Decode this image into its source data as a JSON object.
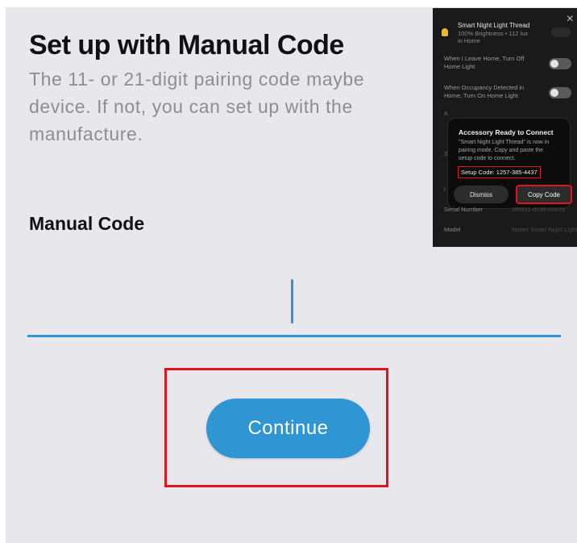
{
  "page": {
    "title": "Set up with Manual Code",
    "description_lines": [
      "The 11- or 21-digit pairing code maybe",
      "device. If not, you can set up with the",
      "manufacture."
    ],
    "field_label": "Manual Code",
    "manual_code_value": "",
    "continue_label": "Continue"
  },
  "inset": {
    "close_glyph": "×",
    "device_name": "Smart Night Light Thread",
    "device_status_line1": "100% Brightness • 112 lux",
    "device_status_line2": "in Home",
    "rows": [
      {
        "line1": "When I Leave Home, Turn Off",
        "line2": "Home Light"
      },
      {
        "line1": "When Occupancy Detected in",
        "line2": "Home, Turn On Home Light"
      }
    ],
    "dialog": {
      "title": "Accessory Ready to Connect",
      "body_lines": [
        "\"Smart Night Light Thread\" is now in",
        "pairing mode. Copy and paste the",
        "setup code to connect."
      ],
      "setup_code": "Setup Code: 1257-385-4437",
      "dismiss_label": "Dismiss",
      "copy_label": "Copy Code"
    },
    "info": [
      {
        "label": "Serial Number",
        "value": "3RM11-6035-00026"
      },
      {
        "label": "Model",
        "value": "Matter Smart Night Light -T"
      }
    ]
  },
  "colors": {
    "background": "#e8e7ec",
    "accent": "#2f95d3",
    "highlight": "#e0141e",
    "title_text": "#111111",
    "description_text": "#8e8d93"
  },
  "icons": {
    "close": "close-icon",
    "bulb": "bulb-icon",
    "cursor": "text-cursor"
  }
}
